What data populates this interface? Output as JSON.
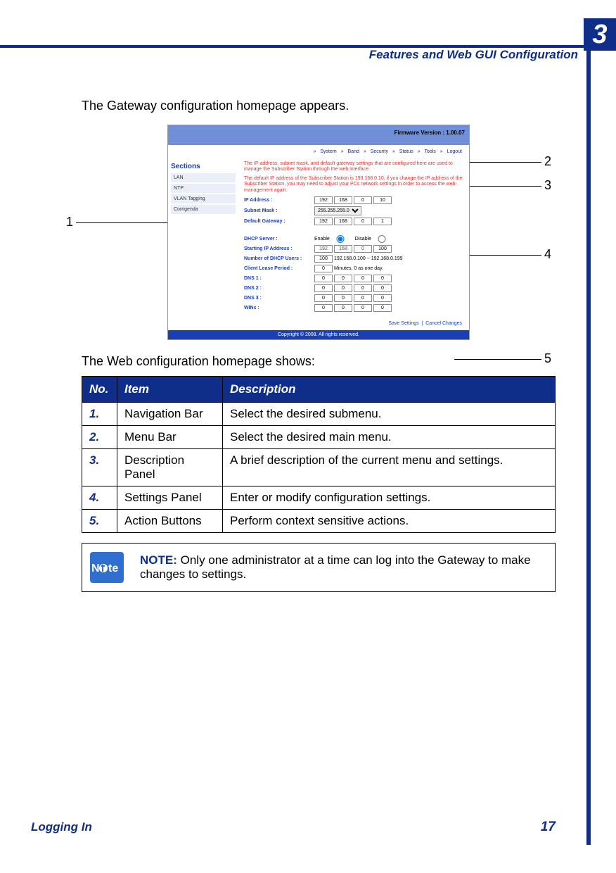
{
  "header": {
    "chapter_number": "3",
    "chapter_title": "Features and Web GUI Configuration"
  },
  "lead": "The Gateway configuration homepage appears.",
  "callouts": {
    "c1": "1",
    "c2": "2",
    "c3": "3",
    "c4": "4",
    "c5": "5"
  },
  "shot": {
    "firmware": "Firmware Version : 1.00.07",
    "menu": [
      "System",
      "Band",
      "Security",
      "Status",
      "Tools",
      "Logout"
    ],
    "sections_title": "Sections",
    "sections": [
      "LAN",
      "NTP",
      "VLAN Tagging",
      "Corrigenda"
    ],
    "desc1": "The IP address, subnet mask, and default gateway settings that are configured here are used to manage the Subscriber Station through the web interface.",
    "desc2": "The default IP address of the Subscriber Station is 193.168.0.10, if you change the IP address of the Subscriber Station, you may need to adjust your PCs network settings in order to access the web-management again.",
    "ip_label": "IP Address :",
    "ip": [
      "192",
      "168",
      "0",
      "10"
    ],
    "subnet_label": "Subnet Mask :",
    "subnet": "255.255.255.0",
    "gw_label": "Default Gateway :",
    "gw": [
      "192",
      "168",
      "0",
      "1"
    ],
    "dhcp_label": "DHCP Server :",
    "dhcp_enable": "Enable",
    "dhcp_disable": "Disable",
    "start_label": "Starting IP Address :",
    "start": [
      "192",
      "168",
      "0",
      "100"
    ],
    "users_label": "Number of DHCP Users :",
    "users": "100",
    "users_range": "192.168.0.100 ~ 192.168.0.199",
    "lease_label": "Client Lease Period :",
    "lease": "0",
    "lease_suffix": "Minutes, 0 as one day.",
    "dns1_label": "DNS 1 :",
    "dns2_label": "DNS 2 :",
    "dns3_label": "DNS 3 :",
    "wins_label": "WINs :",
    "zeros": [
      "0",
      "0",
      "0",
      "0"
    ],
    "save": "Save Settings",
    "cancel": "Cancel Changes",
    "copyright": "Copyright © 2008.  All rights reserved."
  },
  "lead2": "The Web configuration homepage shows:",
  "legend": {
    "headers": {
      "no": "No.",
      "item": "Item",
      "desc": "Description"
    },
    "rows": [
      {
        "no": "1.",
        "item": "Navigation Bar",
        "desc": "Select the desired submenu."
      },
      {
        "no": "2.",
        "item": "Menu Bar",
        "desc": "Select the desired main menu."
      },
      {
        "no": "3.",
        "item": "Description Panel",
        "desc": "A brief description of the current menu and settings."
      },
      {
        "no": "4.",
        "item": "Settings Panel",
        "desc": "Enter or modify configuration settings."
      },
      {
        "no": "5.",
        "item": "Action Buttons",
        "desc": "Perform context sensitive actions."
      }
    ]
  },
  "note": {
    "label": "NOTE:",
    "text": " Only one administrator at a time can log into the Gateway to make changes to settings."
  },
  "footer": {
    "section": "Logging In",
    "page": "17"
  }
}
